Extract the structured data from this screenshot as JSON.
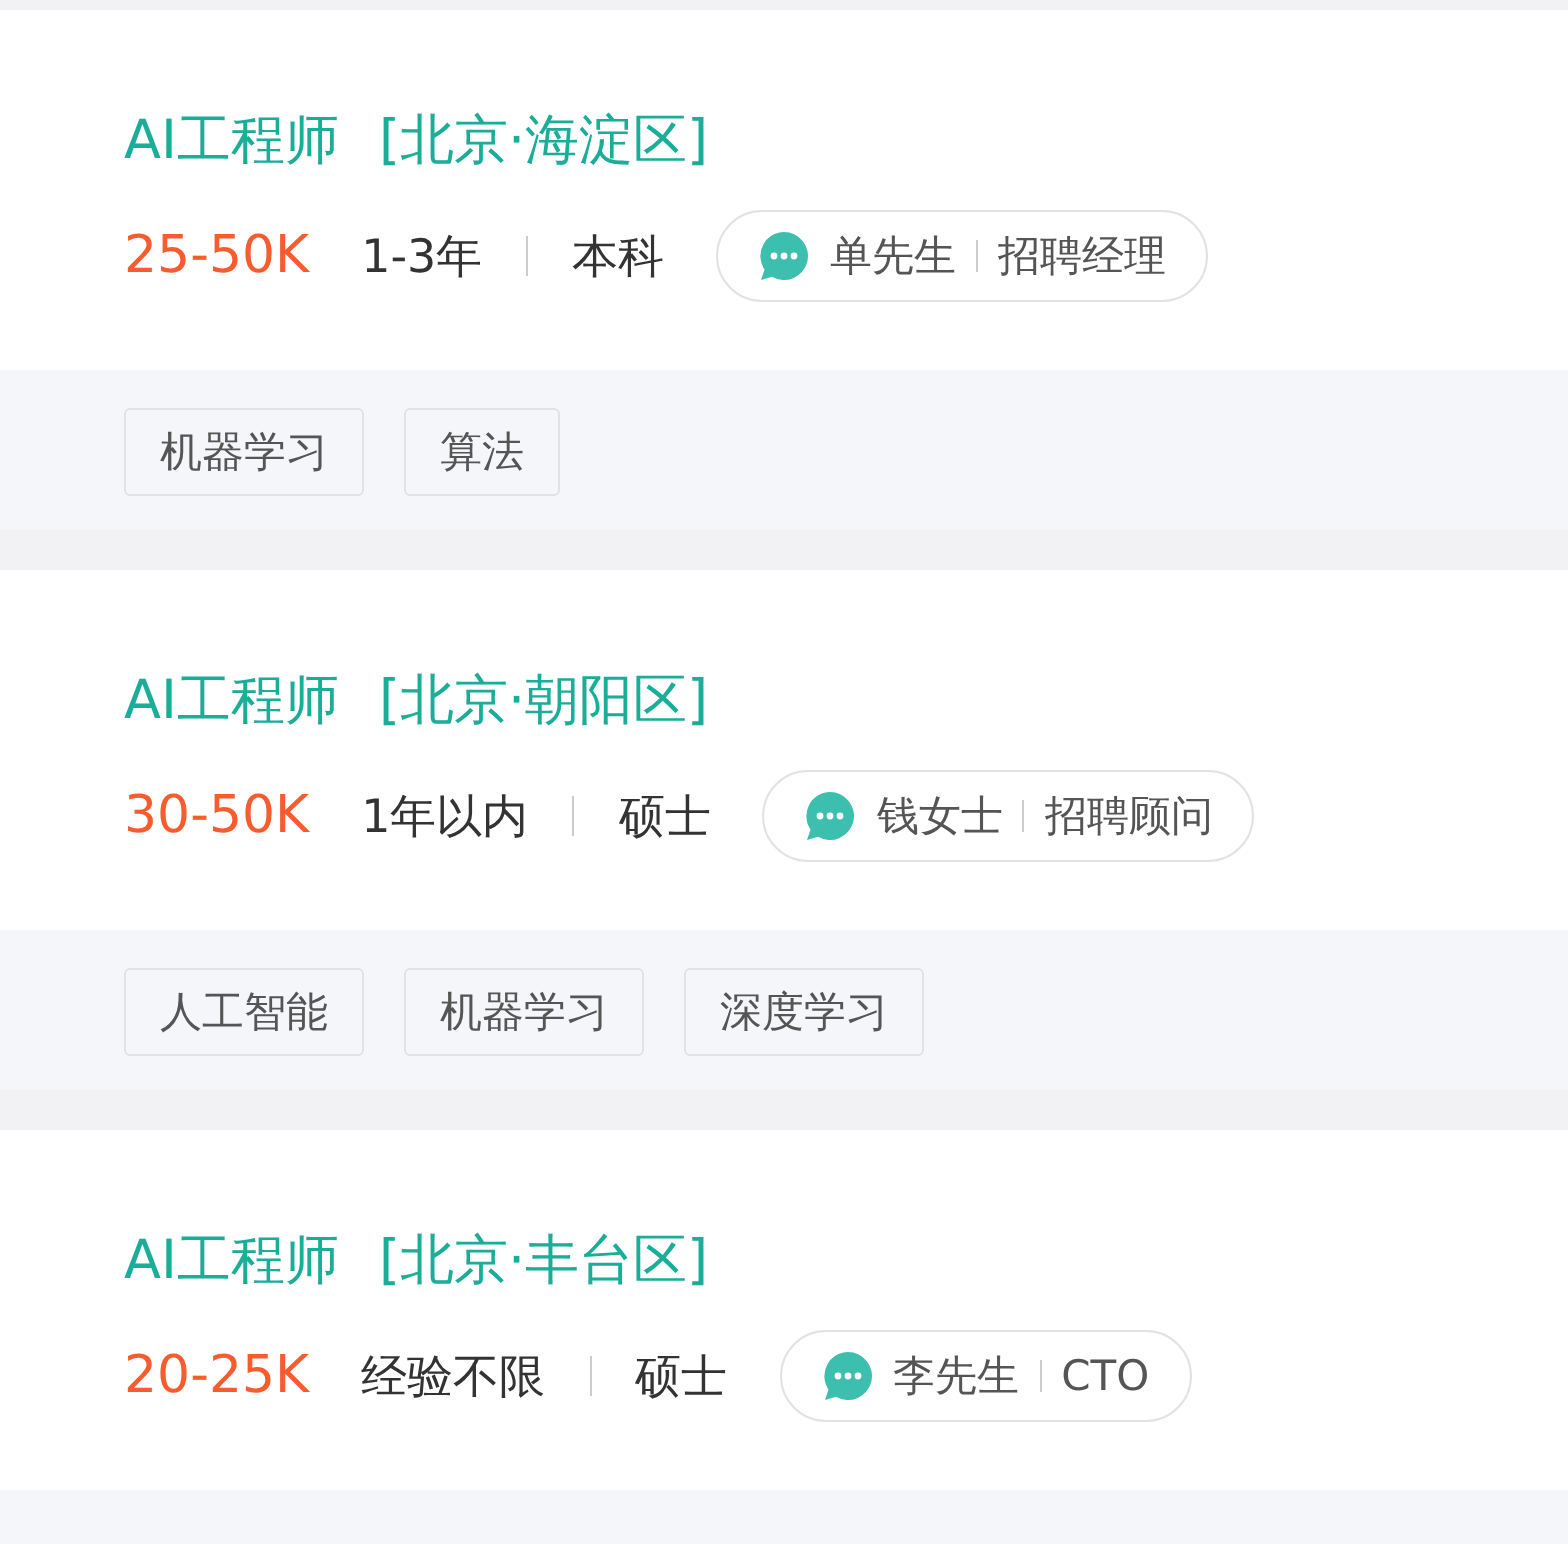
{
  "jobs": [
    {
      "title": "AI工程师",
      "location": "[北京·海淀区]",
      "salary": "25-50K",
      "experience": "1-3年",
      "education": "本科",
      "contact": {
        "name": "单先生",
        "role": "招聘经理"
      },
      "tags": [
        "机器学习",
        "算法"
      ]
    },
    {
      "title": "AI工程师",
      "location": "[北京·朝阳区]",
      "salary": "30-50K",
      "experience": "1年以内",
      "education": "硕士",
      "contact": {
        "name": "钱女士",
        "role": "招聘顾问"
      },
      "tags": [
        "人工智能",
        "机器学习",
        "深度学习"
      ]
    },
    {
      "title": "AI工程师",
      "location": "[北京·丰台区]",
      "salary": "20-25K",
      "experience": "经验不限",
      "education": "硕士",
      "contact": {
        "name": "李先生",
        "role": "CTO"
      }
    }
  ]
}
